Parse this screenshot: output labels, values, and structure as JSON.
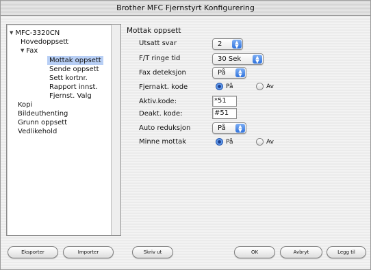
{
  "window": {
    "title": "Brother MFC Fjernstyrt Konfigurering"
  },
  "tree": {
    "root": "MFC-3320CN",
    "items": [
      {
        "label": "Hovedoppsett"
      },
      {
        "label": "Fax"
      },
      {
        "label": "Mottak oppsett",
        "selected": true
      },
      {
        "label": "Sende oppsett"
      },
      {
        "label": "Sett kortnr."
      },
      {
        "label": "Rapport innst."
      },
      {
        "label": "Fjernst. Valg"
      },
      {
        "label": "Kopi"
      },
      {
        "label": "Bildeuthenting"
      },
      {
        "label": "Grunn oppsett"
      },
      {
        "label": "Vedlikehold"
      }
    ]
  },
  "panel": {
    "title": "Mottak oppsett",
    "utsatt_svar": {
      "label": "Utsatt svar",
      "value": "2"
    },
    "ringe_tid": {
      "label": "F/T ringe tid",
      "value": "30 Sek"
    },
    "fax_deteksjon": {
      "label": "Fax deteksjon",
      "value": "På"
    },
    "fjernakt": {
      "label": "Fjernakt. kode",
      "on": "På",
      "off": "Av",
      "selected": "on"
    },
    "aktiv_kode": {
      "label": "Aktiv.kode:",
      "value": "*51"
    },
    "deakt_kode": {
      "label": "Deakt. kode:",
      "value": "#51"
    },
    "auto_reduksjon": {
      "label": "Auto reduksjon",
      "value": "På"
    },
    "minne_mottak": {
      "label": "Minne mottak",
      "on": "På",
      "off": "Av",
      "selected": "on"
    }
  },
  "buttons": {
    "eksporter": "Eksporter",
    "importer": "Importer",
    "skriv_ut": "Skriv ut",
    "ok": "OK",
    "avbryt": "Avbryt",
    "legg_til": "Legg til"
  }
}
